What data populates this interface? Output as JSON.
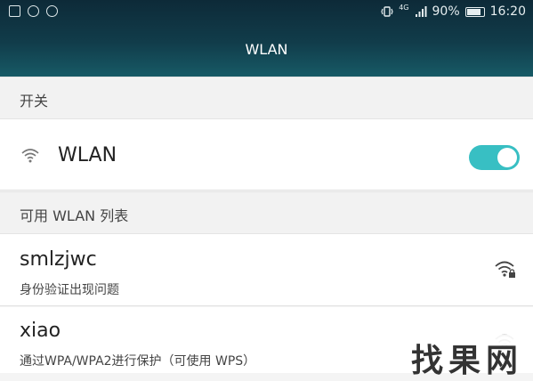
{
  "status_bar": {
    "network_label": "4G",
    "battery": "90%",
    "time": "16:20"
  },
  "header": {
    "title": "WLAN"
  },
  "switch_section": {
    "header": "开关"
  },
  "wlan_row": {
    "label": "WLAN",
    "enabled": true
  },
  "list_section": {
    "header": "可用 WLAN 列表"
  },
  "networks": [
    {
      "name": "smlzjwc",
      "status": "身份验证出现问题",
      "icon": "wifi-lock-icon"
    },
    {
      "name": "xiao",
      "status": "通过WPA/WPA2进行保护（可使用 WPS）",
      "icon": "wifi-lock-icon"
    }
  ],
  "watermark": {
    "text": "找果网"
  },
  "colors": {
    "accent": "#38bfc3",
    "header_top": "#0d2a38",
    "header_bottom": "#175a66"
  }
}
